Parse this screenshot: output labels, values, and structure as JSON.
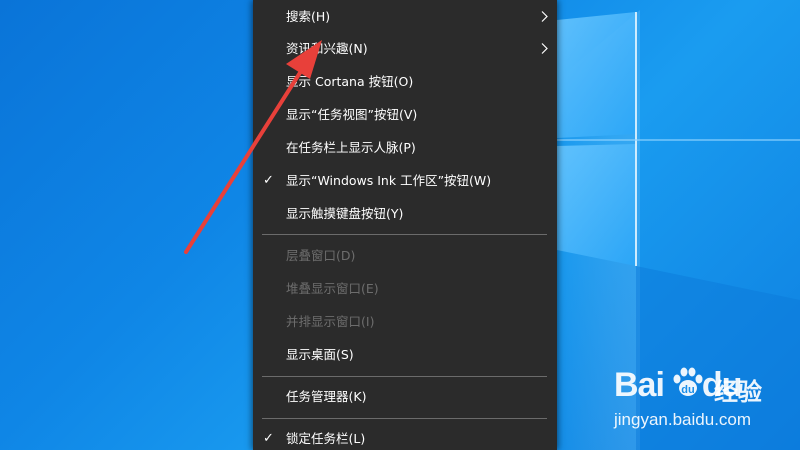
{
  "colors": {
    "desktop_blue": "#0f86e6",
    "menu_background": "#2b2b2b",
    "menu_text": "#ffffff",
    "menu_disabled_text": "#6d6d6d",
    "separator": "#6b6b6b",
    "annotation_arrow": "#e8403a"
  },
  "menu": {
    "items": [
      {
        "label": "搜索(H)",
        "has_submenu": true,
        "checked": false,
        "enabled": true
      },
      {
        "label": "资讯和兴趣(N)",
        "has_submenu": true,
        "checked": false,
        "enabled": true
      },
      {
        "label": "显示 Cortana 按钮(O)",
        "has_submenu": false,
        "checked": false,
        "enabled": true
      },
      {
        "label": "显示“任务视图”按钮(V)",
        "has_submenu": false,
        "checked": false,
        "enabled": true
      },
      {
        "label": "在任务栏上显示人脉(P)",
        "has_submenu": false,
        "checked": false,
        "enabled": true
      },
      {
        "label": "显示“Windows Ink 工作区”按钮(W)",
        "has_submenu": false,
        "checked": true,
        "enabled": true
      },
      {
        "label": "显示触摸键盘按钮(Y)",
        "has_submenu": false,
        "checked": false,
        "enabled": true
      },
      {
        "label": "层叠窗口(D)",
        "has_submenu": false,
        "checked": false,
        "enabled": false
      },
      {
        "label": "堆叠显示窗口(E)",
        "has_submenu": false,
        "checked": false,
        "enabled": false
      },
      {
        "label": "并排显示窗口(I)",
        "has_submenu": false,
        "checked": false,
        "enabled": false
      },
      {
        "label": "显示桌面(S)",
        "has_submenu": false,
        "checked": false,
        "enabled": true
      },
      {
        "label": "任务管理器(K)",
        "has_submenu": false,
        "checked": false,
        "enabled": true
      },
      {
        "label": "锁定任务栏(L)",
        "has_submenu": false,
        "checked": true,
        "enabled": true
      }
    ],
    "check_glyph": "✓"
  },
  "watermark": {
    "logo_text": "Bai",
    "logo_text2": "du",
    "product": "经验",
    "url": "jingyan.baidu.com"
  }
}
